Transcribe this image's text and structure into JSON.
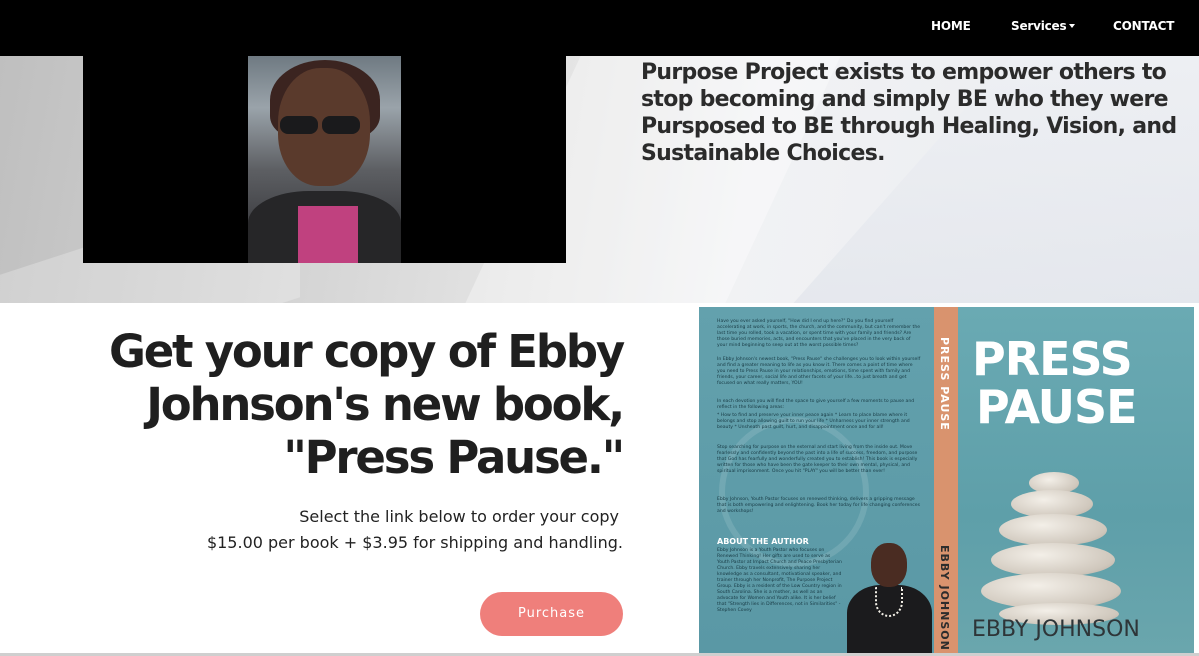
{
  "nav": {
    "home": "HOME",
    "services": "Services",
    "contact": "CONTACT"
  },
  "hero": {
    "tagline": "Purpose Project exists to empower others to stop becoming and simply BE who they were Pursposed to BE through Healing, Vision, and Sustainable Choices."
  },
  "book": {
    "headline_line1": "Get your copy of Ebby",
    "headline_line2": "Johnson's new book,",
    "headline_line3": "\"Press Pause.\"",
    "order_line1": "Select the link below to order your copy",
    "order_line2": "$15.00 per  book + $3.95 for shipping and handling.",
    "purchase_label": "Purchase"
  },
  "cover": {
    "back_paragraphs": [
      "Have you ever asked yourself, \"How did I end up here?\" Do you find yourself accelerating at work, in sports, the church, and the community, but can't remember the last time you rolled, took a vacation, or spent time with your family and friends? Are those buried memories, acts, and encounters that you've placed in the very back of your mind beginning to seep out at the worst possible times?",
      "In Ebby Johnson's newest book, \"Press Pause\" she challenges you to look within yourself and find a greater meaning to life as you know it. There comes a point of time where you need to Press Pause in your relationships, emotions, time spent with family and friends, your career, social life and other facets of your life...to just breath and get focused on what really matters, YOU!",
      "In each devotion you will find the space to give yourself a few moments to pause and reflect in the following areas:",
      "* How to find and preserve your inner peace again  * Learn to place blame where it belongs and stop allowing guilt to run your life  * Unharness your inner strength and beauty  * Unsheath past guilt, hurt, and disappointment once and for all!",
      "Stop searching for purpose on the external and start living from the inside out. Move fearlessly and confidently beyond the past into a life of success, freedom, and purpose that God has fearfully and wonderfully created you to establish! This book is especially written for those who have been the gate keeper to their own mental, physical, and spiritual imprisonment. Once you hit \"PLAY\" you will be better than ever!",
      "Ebby Johnson, Youth Pastor focuses on renewed thinking, delivers a gripping message that is both empowering and enlightening. Book her today for life changing conferences and workshops!"
    ],
    "about_title": "ABOUT THE AUTHOR",
    "about_text": "Ebby Johnson is a Youth Pastor who focuses on Renewed Thinking! Her gifts are used to serve as Youth Pastor at Impact Church and Peace Presbyterian Church. Ebby travels extensively sharing her knowledge as a consultant, motivational speaker, and trainer through her Nonprofit, The Purpose Project Group. Ebby is a resident of the Low Country region in South Carolina. She is a mother, as well as an advocate for Women and Youth alike. It is her belief that \"Strength lies in Differences, not in Similarities\" - Stephen Covey",
    "spine_title": "PRESS PAUSE",
    "spine_author": "EBBY JOHNSON",
    "front_title_line1": "PRESS",
    "front_title_line2": "PAUSE",
    "front_author": "EBBY JOHNSON"
  },
  "colors": {
    "nav_bg": "#000000",
    "button": "#ef7f7b",
    "cover_teal": "#5e9ca8",
    "spine": "#d9936e"
  }
}
